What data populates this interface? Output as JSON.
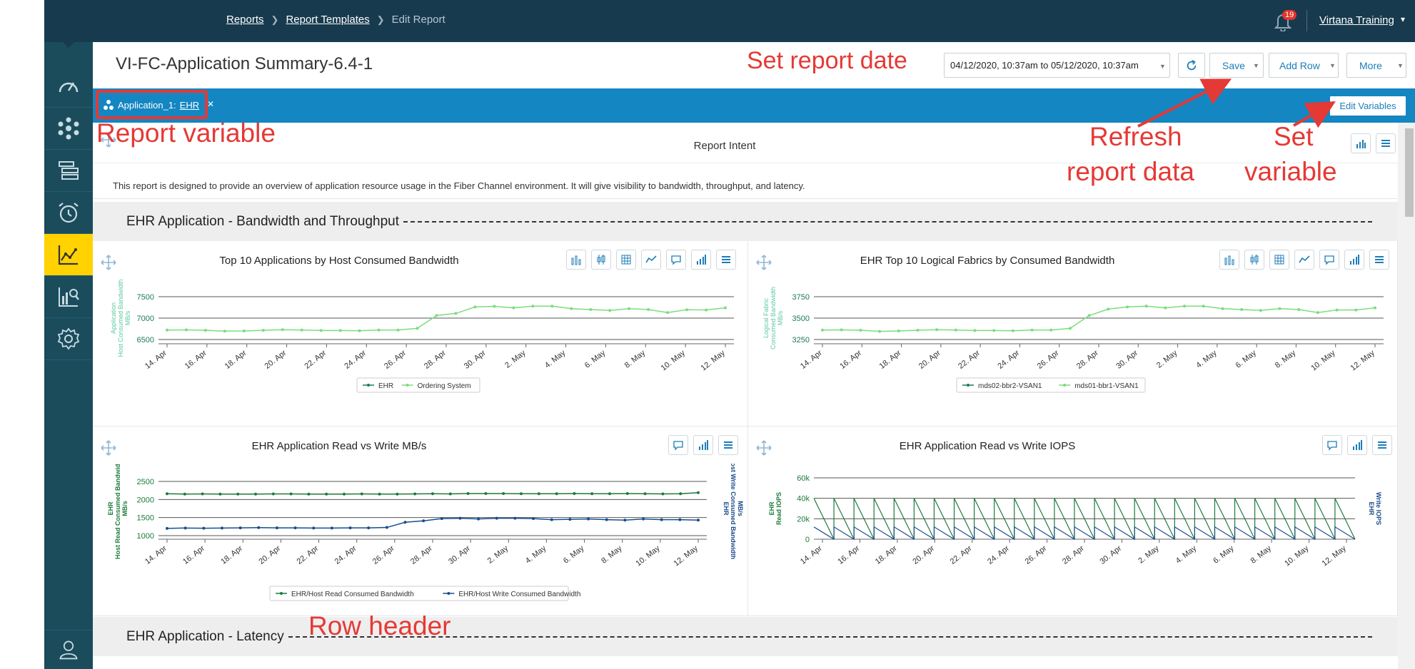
{
  "topbar": {
    "breadcrumbs": [
      "Reports",
      "Report Templates"
    ],
    "current": "Edit Report",
    "notification_count": "19",
    "user": "Virtana Training"
  },
  "sidebar": {
    "items": [
      "dashboard-icon",
      "topology-icon",
      "inventory-icon",
      "alarm-icon",
      "reports-icon",
      "analytics-icon",
      "settings-icon"
    ],
    "active": "reports-icon",
    "footer": "user-icon"
  },
  "title_bar": {
    "report_title": "VI-FC-Application Summary-6.4-1",
    "date_range": "04/12/2020, 10:37am to 05/12/2020, 10:37am",
    "save_label": "Save",
    "add_row_label": "Add Row",
    "more_label": "More"
  },
  "variables": {
    "chip_name": "Application_1:",
    "chip_value": "EHR",
    "edit_label": "Edit Variables"
  },
  "intent": {
    "title": "Report Intent",
    "text": "This report is designed to provide an overview of application resource usage in the Fiber Channel environment.  It will give visibility to bandwidth, throughput, and latency."
  },
  "rows": [
    {
      "title": "EHR Application - Bandwidth and Throughput"
    },
    {
      "title": "EHR Application - Latency"
    }
  ],
  "colors": {
    "accent": "#1486c2",
    "topbar": "#173a4e",
    "sidebar": "#1a4c5c",
    "active": "#ffd200",
    "annotation": "#e53935"
  },
  "annotations": {
    "set_date": "Set report date",
    "report_variable": "Report variable",
    "refresh_1": "Refresh",
    "refresh_2": "report data",
    "set_var_1": "Set",
    "set_var_2": "variable",
    "row_header": "Row header"
  },
  "chart_data": [
    {
      "type": "line",
      "title": "Top 10 Applications by Host Consumed Bandwidth",
      "ylabel": "Application\nHost Consumed Bandwidth\nMB/s",
      "ylim": [
        6400,
        7600
      ],
      "yticks": [
        6500,
        7000,
        7500
      ],
      "xticks": [
        "14. Apr",
        "16. Apr",
        "18. Apr",
        "20. Apr",
        "22. Apr",
        "24. Apr",
        "26. Apr",
        "28. Apr",
        "30. Apr",
        "2. May",
        "4. May",
        "6. May",
        "8. May",
        "10. May",
        "12. May"
      ],
      "series": [
        {
          "name": "EHR",
          "color": "#1e7a5a",
          "values": []
        },
        {
          "name": "Ordering System",
          "color": "#7ddc7d",
          "values": [
            6720,
            6725,
            6715,
            6695,
            6700,
            6715,
            6730,
            6720,
            6710,
            6710,
            6705,
            6720,
            6720,
            6760,
            7060,
            7110,
            7260,
            7275,
            7240,
            7280,
            7280,
            7220,
            7200,
            7180,
            7220,
            7200,
            7130,
            7195,
            7190,
            7240
          ]
        }
      ]
    },
    {
      "type": "line",
      "title": "EHR Top 10 Logical Fabrics by Consumed Bandwidth",
      "ylabel": "Logical Fabric\nConsumed Bandwidth\nMB/s",
      "ylim": [
        3200,
        3800
      ],
      "yticks": [
        3250,
        3500,
        3750
      ],
      "xticks": [
        "14. Apr",
        "16. Apr",
        "18. Apr",
        "20. Apr",
        "22. Apr",
        "24. Apr",
        "26. Apr",
        "28. Apr",
        "30. Apr",
        "2. May",
        "4. May",
        "6. May",
        "8. May",
        "10. May",
        "12. May"
      ],
      "series": [
        {
          "name": "mds02-bbr2-VSAN1",
          "color": "#1e7a5a",
          "values": []
        },
        {
          "name": "mds01-bbr1-VSAN1",
          "color": "#7ddc7d",
          "values": [
            3360,
            3362,
            3358,
            3345,
            3350,
            3358,
            3365,
            3360,
            3355,
            3355,
            3352,
            3360,
            3360,
            3380,
            3530,
            3605,
            3630,
            3640,
            3620,
            3640,
            3640,
            3610,
            3600,
            3590,
            3610,
            3600,
            3565,
            3595,
            3595,
            3620
          ]
        }
      ]
    },
    {
      "type": "line",
      "title": "EHR Application Read vs Write MB/s",
      "ylabel": "EHR\nHost Read Consumed Bandwidth\nMB/s",
      "ylabel_right": "EHR\nHost Write Consumed Bandwidth\nMB/s",
      "ylim": [
        900,
        2600
      ],
      "yticks": [
        1000,
        1500,
        2000,
        2500
      ],
      "xticks": [
        "14. Apr",
        "16. Apr",
        "18. Apr",
        "20. Apr",
        "22. Apr",
        "24. Apr",
        "26. Apr",
        "28. Apr",
        "30. Apr",
        "2. May",
        "4. May",
        "6. May",
        "8. May",
        "10. May",
        "12. May"
      ],
      "series": [
        {
          "name": "EHR/Host Read Consumed Bandwidth",
          "color": "#1e7a3a",
          "values": [
            2160,
            2150,
            2155,
            2150,
            2150,
            2150,
            2155,
            2155,
            2150,
            2150,
            2150,
            2155,
            2150,
            2150,
            2155,
            2160,
            2155,
            2165,
            2165,
            2165,
            2160,
            2160,
            2160,
            2165,
            2160,
            2160,
            2165,
            2160,
            2155,
            2160,
            2190
          ]
        },
        {
          "name": "EHR/Host Write Consumed Bandwidth",
          "color": "#1a4d8c",
          "values": [
            1200,
            1210,
            1205,
            1210,
            1215,
            1220,
            1215,
            1215,
            1210,
            1210,
            1215,
            1215,
            1225,
            1370,
            1410,
            1470,
            1480,
            1460,
            1480,
            1480,
            1470,
            1440,
            1450,
            1460,
            1440,
            1430,
            1460,
            1440,
            1440,
            1430
          ]
        }
      ]
    },
    {
      "type": "line",
      "title": "EHR Application Read vs Write IOPS",
      "ylabel": "EHR\nRead IOPS",
      "ylabel_right": "EHR\nWrite IOPS",
      "ylim": [
        0,
        60000
      ],
      "yticks": [
        "0",
        "20k",
        "40k",
        "60k"
      ],
      "xticks": [
        "14. Apr",
        "16. Apr",
        "18. Apr",
        "20. Apr",
        "22. Apr",
        "24. Apr",
        "26. Apr",
        "28. Apr",
        "30. Apr",
        "2. May",
        "4. May",
        "6. May",
        "8. May",
        "10. May",
        "12. May"
      ],
      "series": [
        {
          "name": "EHR Read IOPS",
          "color": "#1e7a3a",
          "values": [
            40000,
            0
          ]
        },
        {
          "name": "EHR Write IOPS",
          "color": "#1a4d8c",
          "values": [
            12000,
            0
          ]
        }
      ]
    }
  ]
}
